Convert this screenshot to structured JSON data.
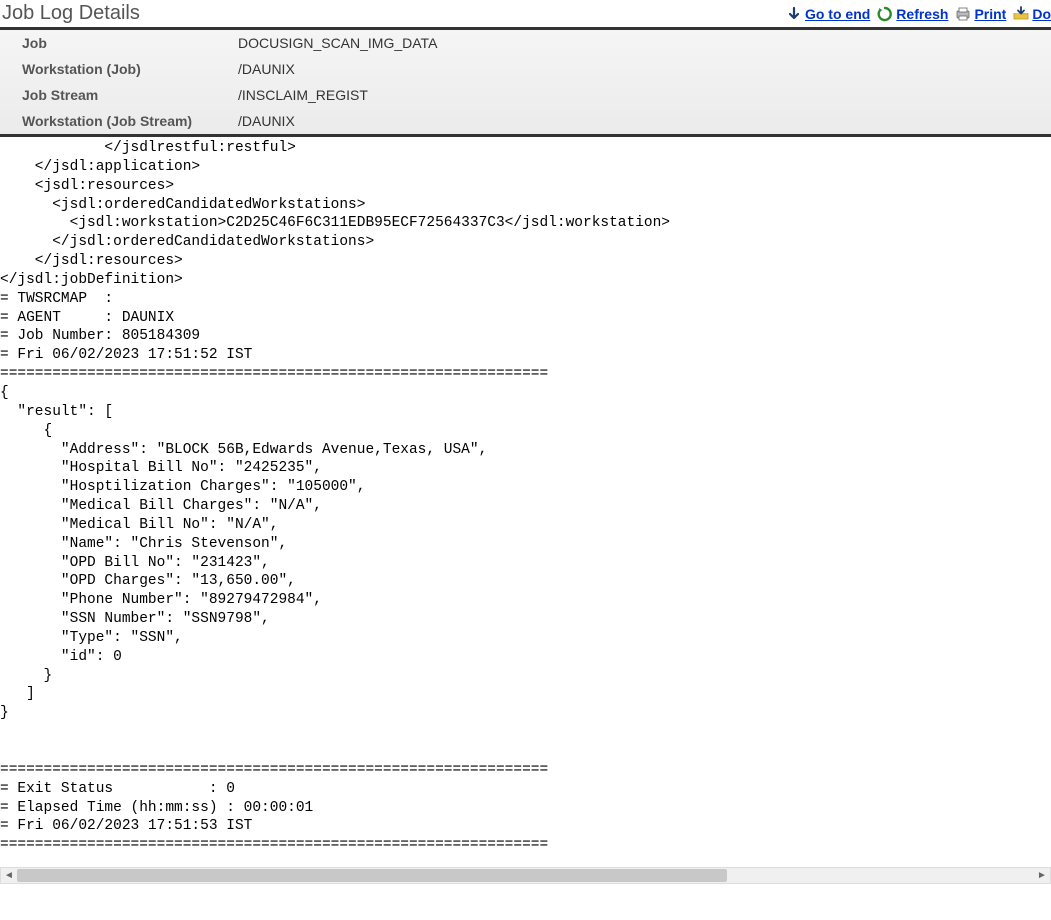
{
  "page_title": "Job Log Details",
  "actions": {
    "goto_end": "Go to end",
    "refresh": "Refresh",
    "print": "Print",
    "download": "Do"
  },
  "info": {
    "job_label": "Job",
    "job_value": "DOCUSIGN_SCAN_IMG_DATA",
    "workstation_job_label": "Workstation (Job)",
    "workstation_job_value": "/DAUNIX",
    "job_stream_label": "Job Stream",
    "job_stream_value": "/INSCLAIM_REGIST",
    "workstation_stream_label": "Workstation (Job Stream)",
    "workstation_stream_value": "/DAUNIX"
  },
  "log": "            </jsdlrestful:restful>\n    </jsdl:application>\n    <jsdl:resources>\n      <jsdl:orderedCandidatedWorkstations>\n        <jsdl:workstation>C2D25C46F6C311EDB95ECF72564337C3</jsdl:workstation>\n      </jsdl:orderedCandidatedWorkstations>\n    </jsdl:resources>\n</jsdl:jobDefinition>\n= TWSRCMAP  :\n= AGENT     : DAUNIX\n= Job Number: 805184309\n= Fri 06/02/2023 17:51:52 IST\n===============================================================\n{\n  \"result\": [\n     {\n       \"Address\": \"BLOCK 56B,Edwards Avenue,Texas, USA\",\n       \"Hospital Bill No\": \"2425235\",\n       \"Hosptilization Charges\": \"105000\",\n       \"Medical Bill Charges\": \"N/A\",\n       \"Medical Bill No\": \"N/A\",\n       \"Name\": \"Chris Stevenson\",\n       \"OPD Bill No\": \"231423\",\n       \"OPD Charges\": \"13,650.00\",\n       \"Phone Number\": \"89279472984\",\n       \"SSN Number\": \"SSN9798\",\n       \"Type\": \"SSN\",\n       \"id\": 0\n     }\n   ]\n}\n\n\n===============================================================\n= Exit Status           : 0\n= Elapsed Time (hh:mm:ss) : 00:00:01\n= Fri 06/02/2023 17:51:53 IST\n==============================================================="
}
